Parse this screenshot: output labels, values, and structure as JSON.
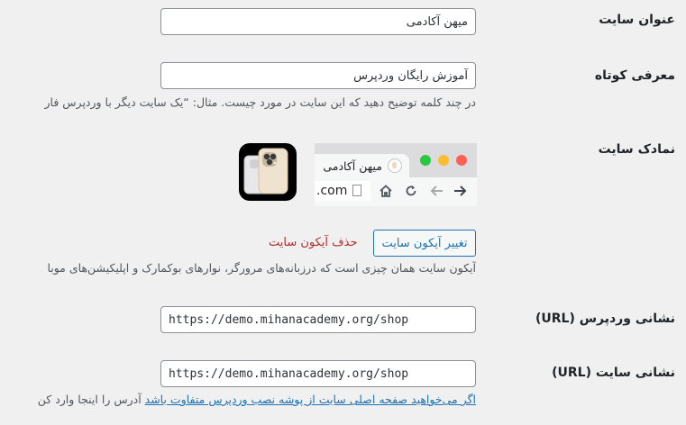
{
  "fields": {
    "site_title": {
      "label": "عنوان سایت",
      "value": "میهن آکادمی"
    },
    "tagline": {
      "label": "معرفی کوتاه",
      "value": "آموزش رایگان وردپرس",
      "description": "در چند کلمه توضیح دهید که این سایت در مورد چیست. مثال: “یک سایت دیگر با وردپرس فار"
    },
    "site_icon": {
      "label": "نمادک سایت",
      "preview_tab_title": "میهن آکادمی",
      "preview_address": ".com",
      "change_button": "تغییر آیکون سایت",
      "remove_link": "حذف آیکون سایت",
      "description": "آیکون سایت همان چیزی است که درزبانه‌های مرورگر، نوارهای بوکمارک و اپلیکیشن‌های موبا"
    },
    "wordpress_url": {
      "label": "نشانی وردپرس (URL)",
      "value": "https://demo.mihanacademy.org/shop"
    },
    "site_url": {
      "label": "نشانی سایت (URL)",
      "value": "https://demo.mihanacademy.org/shop",
      "description_link": "اگر می‌خواهید صفحه اصلی سایت از پوشه نصب وردپرس متفاوت باشد",
      "description_rest": " آدرس را اینجا وارد کن"
    }
  },
  "colors": {
    "background": "#f0f0f1",
    "accent": "#2271b1",
    "danger": "#b32d2e",
    "traffic_red": "#ff5f57",
    "traffic_yellow": "#febc2e",
    "traffic_green": "#28c840"
  },
  "icons": [
    "forward-arrow-icon",
    "back-arrow-icon",
    "reload-icon",
    "home-icon",
    "document-icon",
    "favicon-icon",
    "phone-app-icon"
  ]
}
